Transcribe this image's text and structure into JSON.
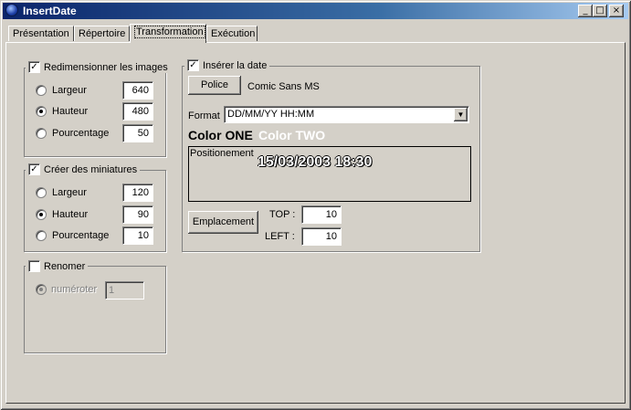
{
  "window": {
    "title": "InsertDate"
  },
  "title_buttons": {
    "minimize": "_",
    "maximize": "□",
    "close": "×"
  },
  "tabs": [
    {
      "label": "Présentation"
    },
    {
      "label": "Répertoire"
    },
    {
      "label": "Transformation"
    },
    {
      "label": "Exécution"
    }
  ],
  "resize": {
    "label": "Redimensionner les images",
    "checked": "✓",
    "options": [
      {
        "label": "Largeur",
        "value": "640"
      },
      {
        "label": "Hauteur",
        "value": "480"
      },
      {
        "label": "Pourcentage",
        "value": "50"
      }
    ]
  },
  "thumbs": {
    "label": "Créer des miniatures",
    "checked": "✓",
    "options": [
      {
        "label": "Largeur",
        "value": "120"
      },
      {
        "label": "Hauteur",
        "value": "90"
      },
      {
        "label": "Pourcentage",
        "value": "10"
      }
    ]
  },
  "rename": {
    "label": "Renomer",
    "number_label": "numéroter",
    "number_value": "1"
  },
  "date": {
    "label": "Insérer la date",
    "checked": "✓",
    "font_button": "Police",
    "font_name": "Comic Sans MS",
    "format_label": "Format",
    "format_value": "DD/MM/YY HH:MM",
    "color_one": "Color ONE",
    "color_two": "Color TWO",
    "position_label": "Positionement",
    "preview_text": "15/03/2003 18:30",
    "place_button": "Emplacement",
    "top_label": "TOP :",
    "top_value": "10",
    "left_label": "LEFT :",
    "left_value": "10",
    "colors": {
      "one": "#000000",
      "two": "#ffffff"
    }
  }
}
